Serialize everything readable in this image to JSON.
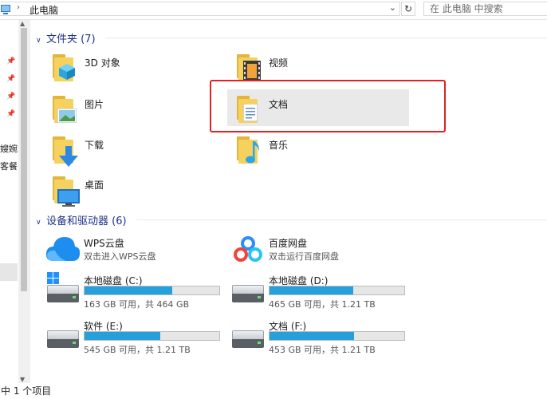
{
  "address": {
    "breadcrumb": "此电脑",
    "search_placeholder": "在 此电脑 中搜索"
  },
  "nav": {
    "truncated_items": [
      "嫂婉",
      "客餐"
    ]
  },
  "groups": {
    "folders": {
      "title": "文件夹 (7)",
      "items": [
        {
          "label": "3D 对象",
          "icon": "3d-objects-icon"
        },
        {
          "label": "视频",
          "icon": "videos-icon"
        },
        {
          "label": "图片",
          "icon": "pictures-icon"
        },
        {
          "label": "文档",
          "icon": "documents-icon",
          "selected": true
        },
        {
          "label": "下载",
          "icon": "downloads-icon"
        },
        {
          "label": "音乐",
          "icon": "music-icon"
        },
        {
          "label": "桌面",
          "icon": "desktop-icon"
        }
      ]
    },
    "devices": {
      "title": "设备和驱动器 (6)",
      "items": [
        {
          "name": "WPS云盘",
          "sub": "双击进入WPS云盘",
          "icon": "wps-cloud-icon"
        },
        {
          "name": "百度网盘",
          "sub": "双击运行百度网盘",
          "icon": "baidu-netdisk-icon"
        },
        {
          "name": "本地磁盘 (C:)",
          "free": "163 GB 可用，共 464 GB",
          "used_fraction": 0.65,
          "icon": "windows-drive-icon"
        },
        {
          "name": "本地磁盘 (D:)",
          "free": "465 GB 可用，共 1.21 TB",
          "used_fraction": 0.62,
          "icon": "hard-drive-icon"
        },
        {
          "name": "软件 (E:)",
          "free": "545 GB 可用，共 1.21 TB",
          "used_fraction": 0.56,
          "icon": "hard-drive-icon"
        },
        {
          "name": "文档 (F:)",
          "free": "453 GB 可用，共 1.21 TB",
          "used_fraction": 0.63,
          "icon": "hard-drive-icon"
        }
      ]
    }
  },
  "status": {
    "text": "中 1 个项目"
  },
  "colors": {
    "accent": "#26a0da",
    "group_header": "#1e3287",
    "highlight_box": "#e02222"
  }
}
